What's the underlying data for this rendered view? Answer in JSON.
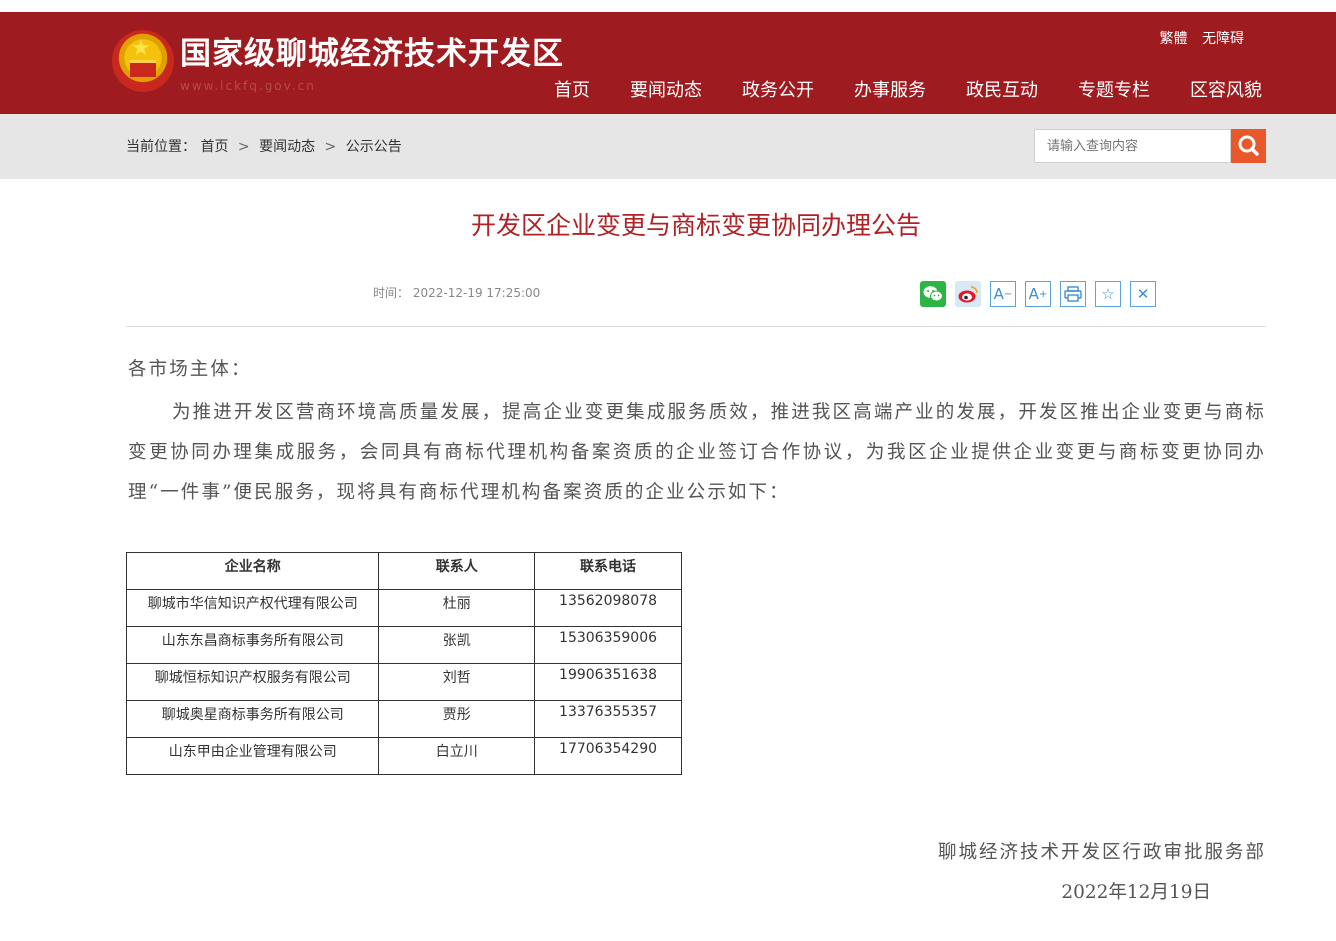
{
  "header": {
    "site_title": "国家级聊城经济技术开发区",
    "site_url": "www.lckfq.gov.cn",
    "top_links": [
      "繁體",
      "无障碍"
    ],
    "nav": [
      "首页",
      "要闻动态",
      "政务公开",
      "办事服务",
      "政民互动",
      "专题专栏",
      "区容风貌"
    ]
  },
  "breadcrumb": {
    "label": "当前位置：",
    "items": [
      "首页",
      "要闻动态",
      "公示公告"
    ],
    "sep": ">"
  },
  "search": {
    "placeholder": "请输入查询内容"
  },
  "article": {
    "title": "开发区企业变更与商标变更协同办理公告",
    "time_label": "时间：",
    "time": "2022-12-19 17:25:00",
    "salutation": "各市场主体：",
    "paragraph": "为推进开发区营商环境高质量发展，提高企业变更集成服务质效，推进我区高端产业的发展，开发区推出企业变更与商标变更协同办理集成服务，会同具有商标代理机构备案资质的企业签订合作协议，为我区企业提供企业变更与商标变更协同办理“一件事”便民服务，现将具有商标代理机构备案资质的企业公示如下：",
    "table": {
      "headers": [
        "企业名称",
        "联系人",
        "联系电话"
      ],
      "rows": [
        [
          "聊城市华信知识产权代理有限公司",
          "杜丽",
          "13562098078"
        ],
        [
          "山东东昌商标事务所有限公司",
          "张凯",
          "15306359006"
        ],
        [
          "聊城恒标知识产权服务有限公司",
          "刘哲",
          "19906351638"
        ],
        [
          "聊城奥星商标事务所有限公司",
          "贾彤",
          "13376355357"
        ],
        [
          "山东甲由企业管理有限公司",
          "白立川",
          "17706354290"
        ]
      ]
    },
    "signature": "聊城经济技术开发区行政审批服务部",
    "date": "2022年12月19日"
  },
  "share_icons": [
    "wechat-icon",
    "weibo-icon",
    "font-decrease-icon",
    "font-increase-icon",
    "print-icon",
    "favorite-icon",
    "close-icon"
  ],
  "colors": {
    "header_bg": "#9e1b20",
    "title_red": "#b02225",
    "search_btn": "#e8582b",
    "tool_blue": "#3d8fd1"
  }
}
